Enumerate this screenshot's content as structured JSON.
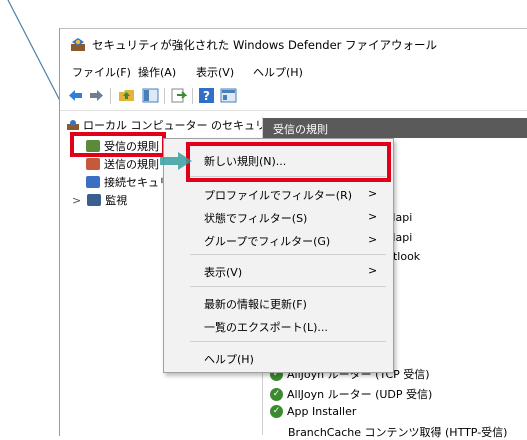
{
  "window": {
    "title": "セキュリティが強化された Windows Defender ファイアウォール"
  },
  "menubar": [
    {
      "label": "ファイル(F)"
    },
    {
      "label": "操作(A)"
    },
    {
      "label": "表示(V)"
    },
    {
      "label": "ヘルプ(H)"
    }
  ],
  "toolbar": {
    "icons": [
      "back-icon",
      "forward-icon",
      "folder-up-icon",
      "show-hide-tree-icon",
      "export-icon",
      "help-icon",
      "properties-icon"
    ]
  },
  "tree": {
    "root": "ローカル コンピューター のセキュリティ",
    "items": [
      {
        "label": "受信の規則",
        "icon": "inbound-rules-icon"
      },
      {
        "label": "送信の規則",
        "icon": "outbound-rules-icon"
      },
      {
        "label": "接続セキュリ",
        "icon": "connection-security-icon"
      },
      {
        "label": "監視",
        "icon": "monitor-icon",
        "expander": ">"
      }
    ]
  },
  "pane": {
    "header": "受信の規則",
    "partial_texts": [
      "Mapi",
      "Mapi",
      "utlook",
      "t"
    ],
    "rules": [
      {
        "label": "AllJoyn ルーター (TCP 受信)"
      },
      {
        "label": "AllJoyn ルーター (UDP 受信)"
      },
      {
        "label": "App Installer"
      },
      {
        "label": "BranchCache コンテンツ取得 (HTTP-受信)"
      }
    ]
  },
  "context_menu": {
    "items": [
      {
        "label": "新しい規則(N)..."
      },
      {
        "label": "プロファイルでフィルター(R)",
        "submenu": ">"
      },
      {
        "label": "状態でフィルター(S)",
        "submenu": ">"
      },
      {
        "label": "グループでフィルター(G)",
        "submenu": ">"
      },
      {
        "label": "表示(V)",
        "submenu": ">"
      },
      {
        "label": "最新の情報に更新(F)"
      },
      {
        "label": "一覧のエクスポート(L)..."
      },
      {
        "label": "ヘルプ(H)"
      }
    ]
  },
  "colors": {
    "highlight_box": "#e0001a",
    "pane_header_bg": "#5a5a5a",
    "pointer_line": "#4a7fa8",
    "check_green": "#3a8a2f"
  }
}
